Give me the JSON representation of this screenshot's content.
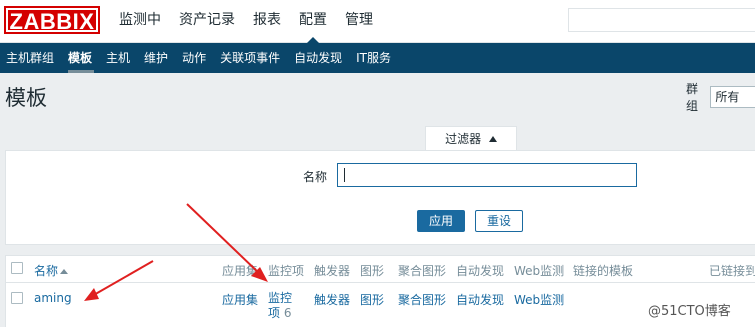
{
  "logo": "ZABBIX",
  "main_nav": [
    "监测中",
    "资产记录",
    "报表",
    "配置",
    "管理"
  ],
  "main_nav_active": "配置",
  "sub_nav": [
    "主机群组",
    "模板",
    "主机",
    "维护",
    "动作",
    "关联项事件",
    "自动发现",
    "IT服务"
  ],
  "sub_nav_active": "模板",
  "page_title": "模板",
  "group_filter": {
    "label": "群组",
    "value": "所有"
  },
  "filter": {
    "tab_label": "过滤器",
    "name_label": "名称",
    "name_value": "",
    "apply_label": "应用",
    "reset_label": "重设"
  },
  "table": {
    "headers": {
      "name": "名称",
      "applications": "应用集",
      "items": "监控项",
      "triggers": "触发器",
      "graphs": "图形",
      "screens": "聚合图形",
      "discovery": "自动发现",
      "web": "Web监测",
      "linked_templates": "链接的模板",
      "linked_to": "已链接到"
    },
    "rows": [
      {
        "name": "aming",
        "applications": "应用集",
        "items_line1": "监控",
        "items_line2": "项",
        "items_count": "6",
        "triggers": "触发器",
        "graphs": "图形",
        "screens": "聚合图形",
        "discovery": "自动发现",
        "web": "Web监测"
      }
    ]
  },
  "watermark": "@51CTO博客",
  "colors": {
    "brand_red": "#d40000",
    "nav_dark": "#0a466a",
    "link_blue": "#1a6aa0",
    "annotation_red": "#e02020"
  }
}
